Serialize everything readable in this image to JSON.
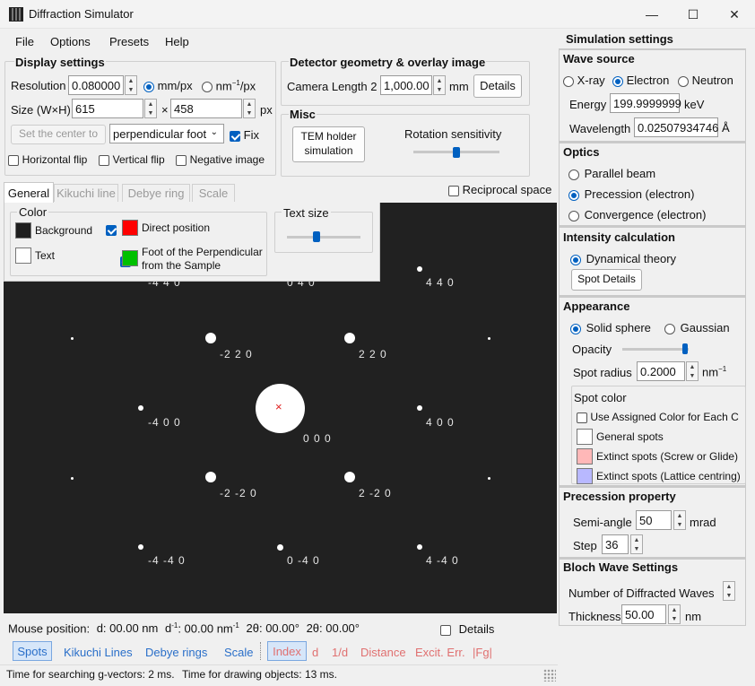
{
  "window": {
    "title": "Diffraction Simulator",
    "minimize_glyph": "—",
    "maximize_glyph": "☐",
    "close_glyph": "✕"
  },
  "menu": {
    "file": "File",
    "options": "Options",
    "presets": "Presets",
    "help": "Help"
  },
  "display_settings": {
    "title": "Display settings",
    "resolution_label": "Resolution",
    "resolution_value": "0.080000",
    "unit_mm": "mm/px",
    "unit_nm_base": "nm",
    "unit_nm_sup": "−1",
    "unit_nm_tail": "/px",
    "size_label": "Size (W×H)",
    "width_value": "615",
    "times": "×",
    "height_value": "458",
    "px": "px",
    "set_center_label": "Set the center to",
    "center_option": "perpendicular foot",
    "fix_label": "Fix",
    "horizontal_flip": "Horizontal flip",
    "vertical_flip": "Vertical flip",
    "negative_image": "Negative image"
  },
  "detector": {
    "title": "Detector geometry & overlay image",
    "camera_length_label": "Camera Length 2",
    "camera_length_value": "1,000.00",
    "unit": "mm",
    "details_button": "Details"
  },
  "misc": {
    "title": "Misc",
    "tem_holder_line1": "TEM  holder",
    "tem_holder_line2": "simulation",
    "rotation_label": "Rotation sensitivity",
    "rotation_value": 0.5
  },
  "tabs": {
    "general": "General",
    "kikuchi": "Kikuchi line",
    "debye": "Debye ring",
    "scale": "Scale"
  },
  "reciprocal_space": "Reciprocal space",
  "color_group": {
    "title": "Color",
    "background": "Background",
    "text": "Text",
    "direct_position": "Direct position",
    "foot_line1": "Foot of the Perpendicular",
    "foot_line2": "from the Sample",
    "colors": {
      "background": "#1e1e1e",
      "text": "#ffffff",
      "direct": "#ff0000",
      "foot": "#00c000"
    }
  },
  "text_size": {
    "title": "Text size",
    "value": 0.4
  },
  "pattern": {
    "labels": {
      "l1": "-4 4 0",
      "l2": "0 4 0",
      "l3": "4 4 0",
      "l4": "-2 2 0",
      "l5": "2 2 0",
      "l6": "-4 0 0",
      "l7": "0 0 0",
      "l8": "4 0 0",
      "l9": "-2 -2 0",
      "l10": "2 -2 0",
      "l11": "-4 -4 0",
      "l12": "0 -4 0",
      "l13": "4 -4 0"
    },
    "center_mark": "×"
  },
  "mouse_position": {
    "label": "Mouse position:",
    "d": "d: 00.00 nm",
    "dinv_base": "d",
    "dinv_sup": "-1",
    "dinv_value": ": 00.00 nm",
    "dinv_unit_sup": "-1",
    "two_theta1": "2θ: 00.00°",
    "two_theta2": "2θ: 00.00°",
    "details": "Details"
  },
  "bottom_tabs": {
    "spots": "Spots",
    "kikuchi": "Kikuchi Lines",
    "debye": "Debye rings",
    "scale": "Scale",
    "index": "Index",
    "d": "d",
    "one_over_d": "1/d",
    "distance": "Distance",
    "excit": "Excit. Err.",
    "fg": "|Fg|"
  },
  "status": {
    "search": "Time for searching g-vectors: 2 ms.",
    "draw": "Time for drawing objects: 13 ms."
  },
  "right": {
    "title": "Simulation settings",
    "wave_source": {
      "title": "Wave source",
      "xray": "X-ray",
      "electron": "Electron",
      "neutron": "Neutron",
      "energy_label": "Energy",
      "energy_value": "199.9999999",
      "energy_unit": "keV",
      "wavelength_label": "Wavelength",
      "wavelength_value": "0.02507934746",
      "wavelength_unit": "Å"
    },
    "optics": {
      "title": "Optics",
      "parallel": "Parallel beam",
      "precession": "Precession (electron)",
      "convergence": "Convergence (electron)"
    },
    "intensity": {
      "title": "Intensity calculation",
      "dynamical": "Dynamical theory",
      "spot_details": "Spot Details"
    },
    "appearance": {
      "title": "Appearance",
      "solid": "Solid sphere",
      "gaussian": "Gaussian",
      "opacity_label": "Opacity",
      "opacity_value": 0.95,
      "radius_label": "Spot radius",
      "radius_value": "0.2000",
      "radius_unit_base": "nm",
      "radius_unit_sup": "−1"
    },
    "spot_color": {
      "title": "Spot color",
      "use_assigned": "Use Assigned Color for Each C",
      "general": "General spots",
      "extinct_screw": "Extinct spots (Screw or Glide)",
      "extinct_lattice": "Extinct spots (Lattice centring)",
      "colors": {
        "general": "#ffffff",
        "screw": "#ffb8b8",
        "lattice": "#b8b8ff"
      }
    },
    "precession": {
      "title": "Precession property",
      "semi_label": "Semi-angle",
      "semi_value": "50",
      "semi_unit": "mrad",
      "step_label": "Step",
      "step_value": "36"
    },
    "bloch": {
      "title": "Bloch Wave Settings",
      "num_label": "Number of Diffracted Waves",
      "thickness_label": "Thickness",
      "thickness_value": "50.00",
      "thickness_unit": "nm"
    }
  }
}
